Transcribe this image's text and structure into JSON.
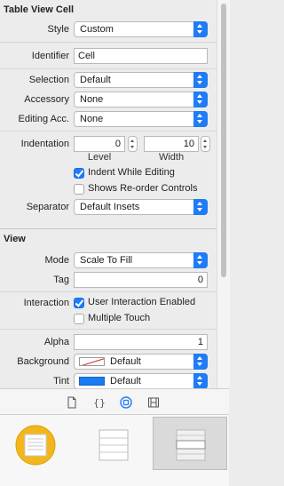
{
  "table_view_cell": {
    "title": "Table View Cell",
    "style": {
      "label": "Style",
      "value": "Custom"
    },
    "identifier": {
      "label": "Identifier",
      "value": "Cell"
    },
    "selection": {
      "label": "Selection",
      "value": "Default"
    },
    "accessory": {
      "label": "Accessory",
      "value": "None"
    },
    "editing_acc": {
      "label": "Editing Acc.",
      "value": "None"
    },
    "indentation": {
      "label": "Indentation",
      "level_value": "0",
      "width_value": "10",
      "level_label": "Level",
      "width_label": "Width"
    },
    "indent_while_editing": {
      "label": "Indent While Editing",
      "checked": true
    },
    "shows_reorder": {
      "label": "Shows Re-order Controls",
      "checked": false
    },
    "separator": {
      "label": "Separator",
      "value": "Default Insets"
    }
  },
  "view": {
    "title": "View",
    "mode": {
      "label": "Mode",
      "value": "Scale To Fill"
    },
    "tag": {
      "label": "Tag",
      "value": "0"
    },
    "interaction": {
      "label": "Interaction",
      "user_interaction": "User Interaction Enabled",
      "user_interaction_checked": true,
      "multiple_touch": "Multiple Touch",
      "multiple_touch_checked": false
    },
    "alpha": {
      "label": "Alpha",
      "value": "1"
    },
    "background": {
      "label": "Background",
      "value": "Default",
      "swatch": "clear"
    },
    "tint": {
      "label": "Tint",
      "value": "Default",
      "swatch": "#1a7cf3"
    }
  },
  "library_tabs": [
    "file-template-icon",
    "code-snippet-icon",
    "object-library-icon",
    "media-library-icon"
  ],
  "library_items": [
    "view-controller-icon",
    "table-view-icon",
    "table-view-cell-icon"
  ],
  "colors": {
    "accent": "#1f7cf4",
    "selected_tab": "#1f7cf4"
  }
}
